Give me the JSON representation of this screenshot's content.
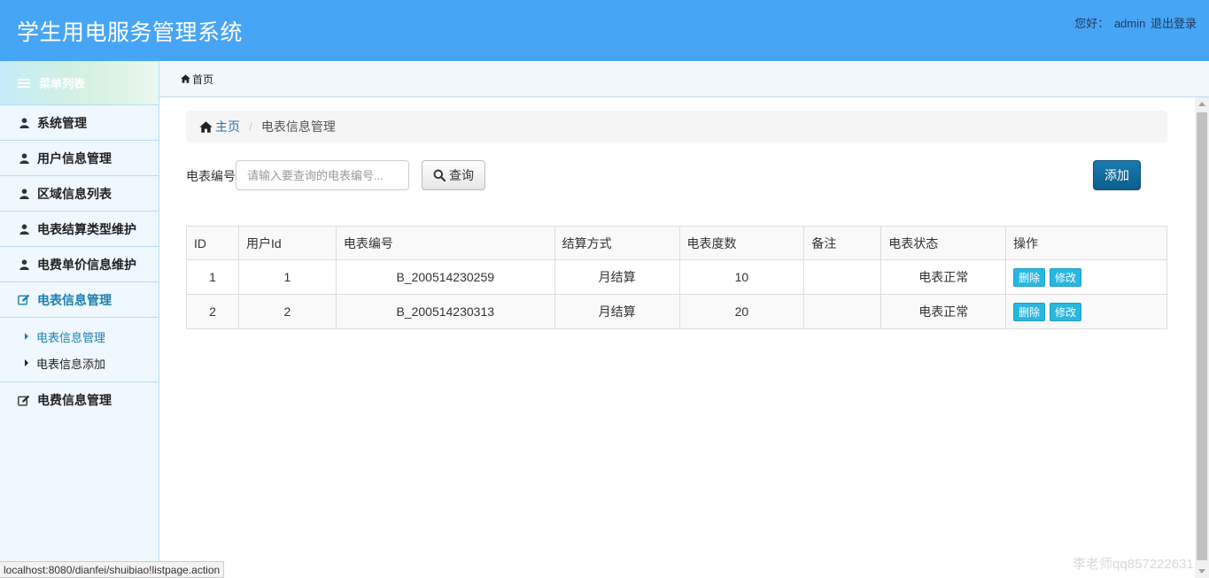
{
  "header": {
    "title": "学生用电服务管理系统",
    "greeting": "您好：",
    "username": "admin",
    "logout": "退出登录"
  },
  "sidebar": {
    "menu_title": "菜单列表",
    "items": [
      {
        "label": "系统管理",
        "icon": "user-icon"
      },
      {
        "label": "用户信息管理",
        "icon": "user-icon"
      },
      {
        "label": "区域信息列表",
        "icon": "user-icon"
      },
      {
        "label": "电表结算类型维护",
        "icon": "user-icon"
      },
      {
        "label": "电费单价信息维护",
        "icon": "user-icon"
      },
      {
        "label": "电表信息管理",
        "icon": "edit-icon",
        "expanded": true
      },
      {
        "label": "电费信息管理",
        "icon": "edit-icon"
      }
    ],
    "submenu": [
      {
        "label": "电表信息管理",
        "active": true
      },
      {
        "label": "电表信息添加",
        "active": false
      }
    ]
  },
  "tabbar": {
    "home_tab": "首页"
  },
  "breadcrumb": {
    "home": "主页",
    "current": "电表信息管理"
  },
  "search": {
    "label": "电表编号",
    "placeholder": "请输入要查询的电表编号...",
    "query_button": "查询",
    "add_button": "添加"
  },
  "table": {
    "headers": [
      "ID",
      "用户Id",
      "电表编号",
      "结算方式",
      "电表度数",
      "备注",
      "电表状态",
      "操作"
    ],
    "rows": [
      {
        "id": "1",
        "user_id": "1",
        "meter_no": "B_200514230259",
        "settle": "月结算",
        "reading": "10",
        "remark": "",
        "status": "电表正常"
      },
      {
        "id": "2",
        "user_id": "2",
        "meter_no": "B_200514230313",
        "settle": "月结算",
        "reading": "20",
        "remark": "",
        "status": "电表正常"
      }
    ],
    "delete_label": "删除",
    "edit_label": "修改"
  },
  "statusbar": {
    "url": "localhost:8080/dianfei/shuibiao!listpage.action"
  },
  "watermark": "李老师qq857222631",
  "colors": {
    "header_bg": "#47a5f5",
    "sidebar_bg": "#eff8fe",
    "primary_button": "#0c5d8e",
    "info_button": "#29b7e0",
    "link": "#2a6fb0"
  }
}
